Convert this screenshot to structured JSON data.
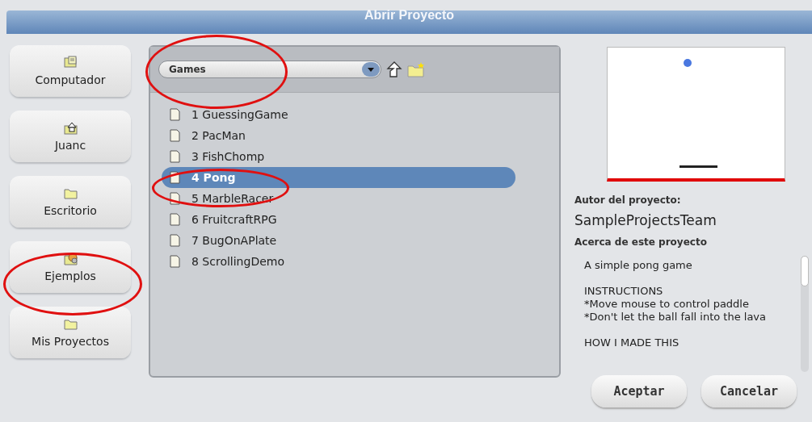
{
  "window": {
    "title": "Abrir Proyecto"
  },
  "sidebar": {
    "items": [
      {
        "label": "Computador",
        "kind": "computer"
      },
      {
        "label": "Juanc",
        "kind": "home"
      },
      {
        "label": "Escritorio",
        "kind": "folder"
      },
      {
        "label": "Ejemplos",
        "kind": "examples"
      },
      {
        "label": "Mis Proyectos",
        "kind": "folder"
      }
    ]
  },
  "folder_select": {
    "value": "Games"
  },
  "files": [
    {
      "name": "1 GuessingGame",
      "selected": false
    },
    {
      "name": "2 PacMan",
      "selected": false
    },
    {
      "name": "3 FishChomp",
      "selected": false
    },
    {
      "name": "4 Pong",
      "selected": true
    },
    {
      "name": "5 MarbleRacer",
      "selected": false
    },
    {
      "name": "6 FruitcraftRPG",
      "selected": false
    },
    {
      "name": "7 BugOnAPlate",
      "selected": false
    },
    {
      "name": "8 ScrollingDemo",
      "selected": false
    }
  ],
  "details": {
    "author_label": "Autor del proyecto:",
    "author": "SampleProjectsTeam",
    "about_label": "Acerca de este proyecto",
    "about_paragraphs": [
      "A simple pong game",
      "INSTRUCTIONS\n*Move mouse to control paddle\n*Don't let the ball fall into the lava",
      "HOW I MADE THIS"
    ]
  },
  "buttons": [
    "Aceptar",
    "Cancelar"
  ]
}
